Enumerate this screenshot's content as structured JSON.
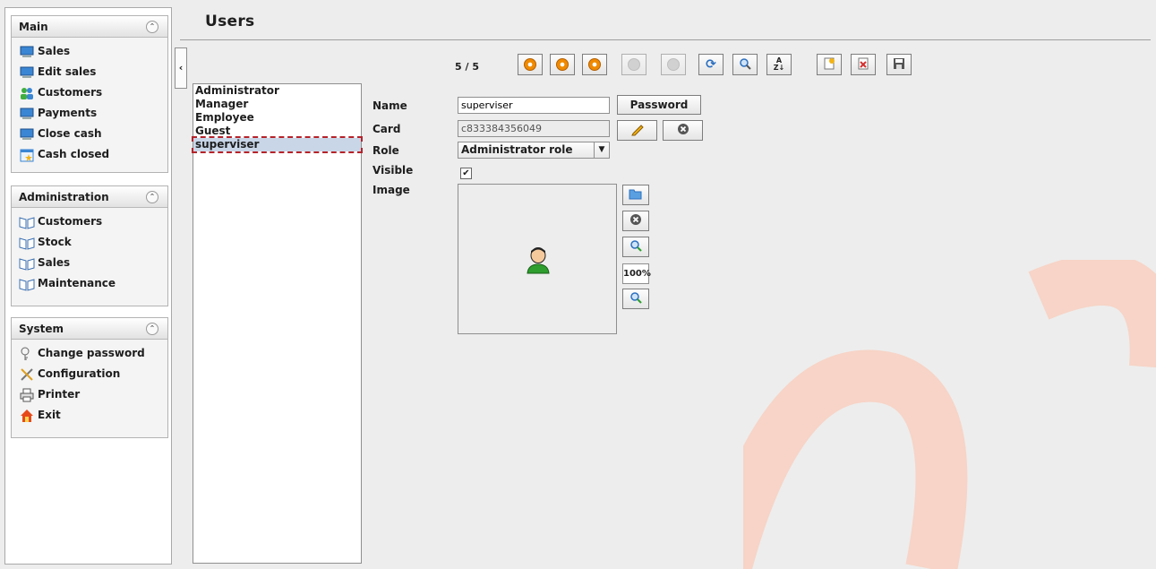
{
  "sidebar": {
    "main": {
      "title": "Main",
      "items": [
        {
          "label": "Sales",
          "icon": "monitor-icon"
        },
        {
          "label": "Edit sales",
          "icon": "monitor-icon"
        },
        {
          "label": "Customers",
          "icon": "people-icon"
        },
        {
          "label": "Payments",
          "icon": "monitor-icon"
        },
        {
          "label": "Close cash",
          "icon": "monitor-icon"
        },
        {
          "label": "Cash closed",
          "icon": "calendar-icon"
        }
      ]
    },
    "administration": {
      "title": "Administration",
      "items": [
        {
          "label": "Customers",
          "icon": "book-icon"
        },
        {
          "label": "Stock",
          "icon": "book-icon"
        },
        {
          "label": "Sales",
          "icon": "book-icon"
        },
        {
          "label": "Maintenance",
          "icon": "book-icon"
        }
      ]
    },
    "system": {
      "title": "System",
      "items": [
        {
          "label": "Change password",
          "icon": "key-icon"
        },
        {
          "label": "Configuration",
          "icon": "tools-icon"
        },
        {
          "label": "Printer",
          "icon": "printer-icon"
        },
        {
          "label": "Exit",
          "icon": "home-icon"
        }
      ]
    }
  },
  "page": {
    "title": "Users"
  },
  "users": [
    "Administrator",
    "Manager",
    "Employee",
    "Guest",
    "superviser"
  ],
  "selected_user_index": 4,
  "toolbar": {
    "counter": "5 / 5",
    "buttons": [
      "first-icon",
      "previous-icon",
      "next-icon",
      "last-icon",
      "stop-icon",
      "reload-icon",
      "search-icon",
      "sort-icon",
      "new-icon",
      "delete-icon",
      "save-icon"
    ]
  },
  "form": {
    "name_label": "Name",
    "name_value": "superviser",
    "password_button": "Password",
    "card_label": "Card",
    "card_value": "c833384356049",
    "role_label": "Role",
    "role_value": "Administrator role",
    "visible_label": "Visible",
    "visible_checked": true,
    "image_label": "Image",
    "zoom": "100%"
  },
  "colors": {
    "accent_selection": "#c8d6e8",
    "focus_border": "#b4232a",
    "watermark": "#f7d4c7"
  }
}
